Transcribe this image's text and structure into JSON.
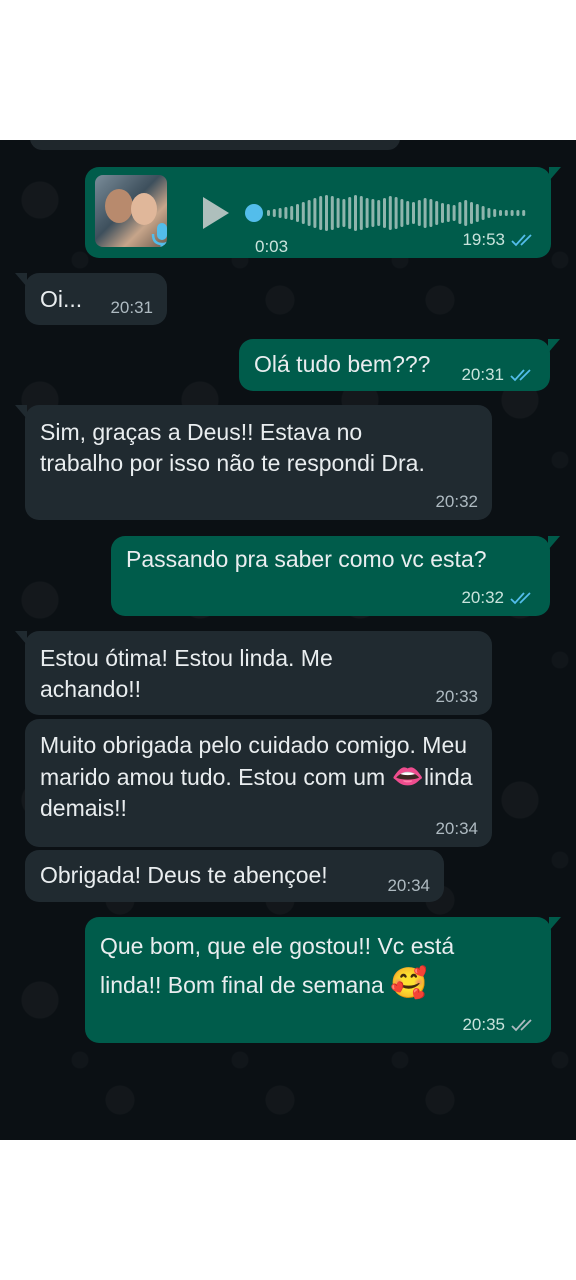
{
  "voice_message": {
    "duration": "0:03",
    "time": "19:53",
    "progress": 0.0
  },
  "messages": [
    {
      "dir": "in",
      "text": "Oi...",
      "time": "20:31"
    },
    {
      "dir": "out",
      "text": "Olá tudo bem???",
      "time": "20:31"
    },
    {
      "dir": "in",
      "text": "Sim, graças a Deus!! Estava no trabalho por isso não te respondi Dra.",
      "time": "20:32"
    },
    {
      "dir": "out",
      "text": "Passando pra saber como vc esta?",
      "time": "20:32"
    },
    {
      "dir": "in",
      "text": "Estou ótima! Estou linda. Me achando!!",
      "time": "20:33"
    },
    {
      "dir": "in",
      "text_before": "Muito obrigada pelo cuidado comigo. Meu marido amou tudo. Estou com um ",
      "emoji": "👄",
      "text_after": "linda demais!!",
      "time": "20:34"
    },
    {
      "dir": "in",
      "text": "Obrigada! Deus te abençoe!",
      "time": "20:34"
    },
    {
      "dir": "out",
      "text_before": "Que bom, que ele gostou!! Vc está linda!! Bom final de semana ",
      "emoji": "🥰",
      "time": "20:35"
    }
  ],
  "colors": {
    "background": "#0b1014",
    "incoming_bubble": "#202a30",
    "outgoing_bubble": "#005c4b",
    "read_tick": "#53bdeb",
    "delivered_tick": "#aebac1"
  },
  "icons": [
    "play-icon",
    "mic-icon",
    "double-check-icon"
  ]
}
